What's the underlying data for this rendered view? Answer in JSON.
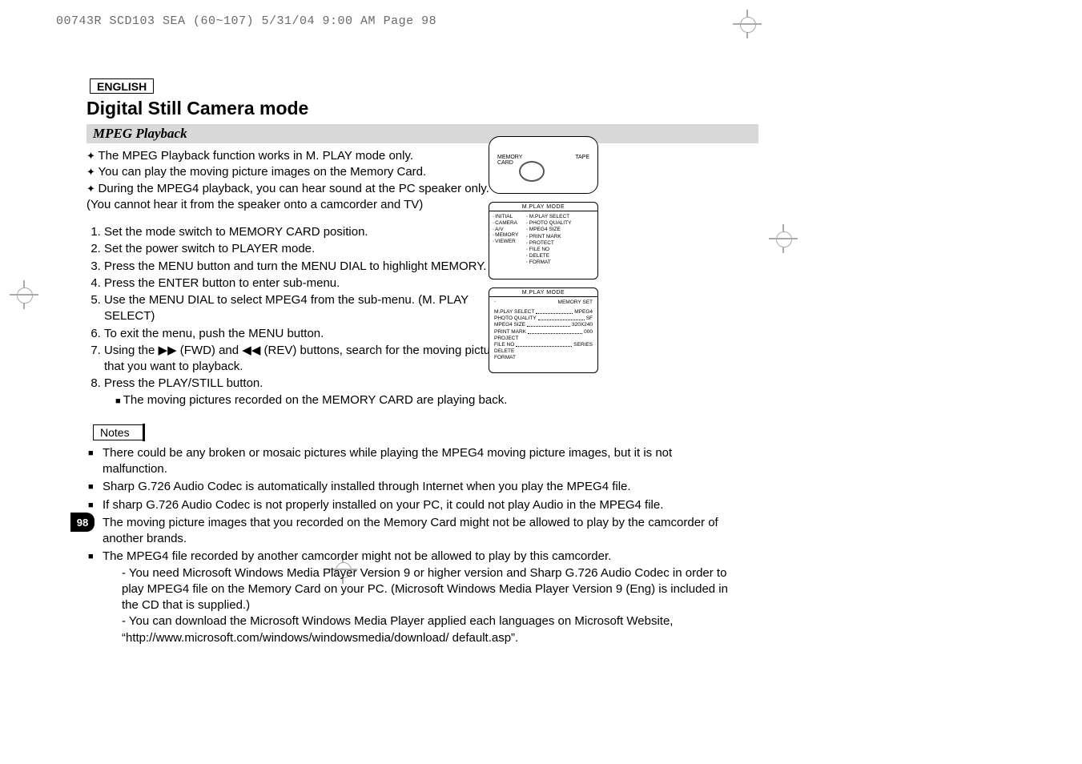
{
  "print_header": "00743R SCD103 SEA (60~107)  5/31/04 9:00 AM  Page 98",
  "language_box": "ENGLISH",
  "page_title": "Digital Still Camera mode",
  "subsection_title": "MPEG Playback",
  "page_number": "98",
  "bullets": [
    "The MPEG Playback function works in M. PLAY mode only.",
    "You can play the moving picture images on the Memory Card.",
    "During the MPEG4 playback, you can hear sound at the PC speaker only. (You cannot hear it from the speaker onto a camcorder and TV)"
  ],
  "steps": [
    "Set the mode switch to MEMORY CARD position.",
    "Set the power switch to PLAYER mode.",
    "Press the MENU button and turn the MENU DIAL to highlight MEMORY.",
    "Press the ENTER button to enter sub-menu.",
    "Use the MENU DIAL to select MPEG4 from the sub-menu. (M. PLAY SELECT)",
    "To exit the menu, push the MENU button.",
    "Using the ▶▶ (FWD) and ◀◀ (REV) buttons, search for the moving picture that you want to playback.",
    "Press the PLAY/STILL button."
  ],
  "step_subitem": "The moving pictures recorded on the MEMORY CARD are playing back.",
  "notes_label": "Notes",
  "notes": [
    "There could be any broken or mosaic pictures while playing the MPEG4 moving picture images, but it is not malfunction.",
    "Sharp G.726 Audio Codec is automatically installed through Internet when you play the MPEG4 file.",
    "If sharp G.726 Audio Codec is not properly installed on your PC, it could not play Audio in the MPEG4 file.",
    "The moving picture images that you recorded on the Memory Card might not be allowed to play by the camcorder of another brands.",
    "The MPEG4 file recorded by another camcorder might not be allowed to play by this camcorder."
  ],
  "notes_sub": [
    "You need Microsoft Windows Media Player Version 9 or higher version and Sharp G.726 Audio Codec in order to play MPEG4 file on the Memory Card on your PC. (Microsoft Windows Media Player Version 9 (Eng) is included in the CD that is supplied.)",
    "You can download the Microsoft Windows Media Player applied each languages on Microsoft Website, “http://www.microsoft.com/windows/windowsmedia/download/ default.asp”."
  ],
  "diagram": {
    "memory_label": "MEMORY",
    "card_label": "CARD",
    "tape_label": "TAPE"
  },
  "menu1": {
    "title": "M.PLAY  MODE",
    "left": [
      "INITIAL",
      "CAMERA",
      "A/V",
      "MEMORY",
      "VIEWER"
    ],
    "right": [
      "M.PLAY SELECT",
      "PHOTO QUALITY",
      "MPEG4 SIZE",
      "PRINT MARK",
      "PROTECT",
      "FILE NO",
      "DELETE",
      "FORMAT"
    ]
  },
  "menu2": {
    "title": "M.PLAY  MODE",
    "subtitle": "MEMORY SET",
    "rows": [
      {
        "l": "M.PLAY SELECT",
        "r": "MPEG4"
      },
      {
        "l": "PHOTO QUALITY",
        "r": "SF"
      },
      {
        "l": "MPEG4 SIZE",
        "r": "320X240"
      },
      {
        "l": "PRINT MARK",
        "r": "000"
      },
      {
        "l": "PROJECT",
        "r": ""
      },
      {
        "l": "FILE NO",
        "r": "SERIES"
      },
      {
        "l": "DELETE",
        "r": ""
      },
      {
        "l": "FORMAT",
        "r": ""
      }
    ]
  }
}
